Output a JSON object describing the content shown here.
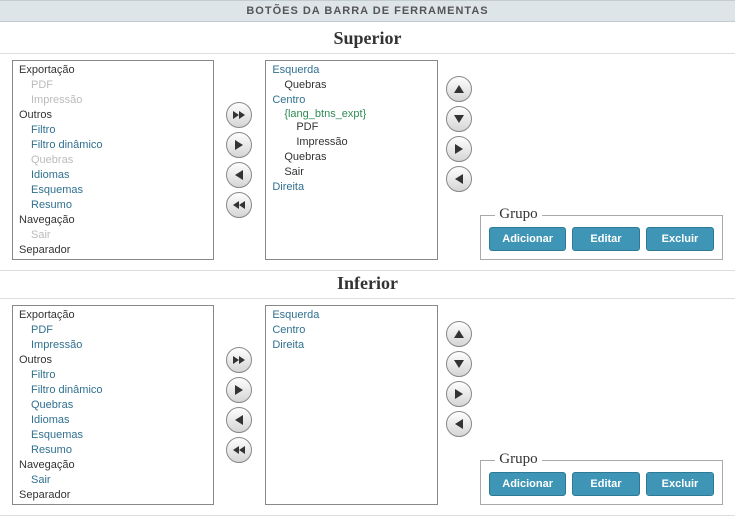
{
  "header": "BOTÕES DA BARRA DE FERRAMENTAS",
  "sections": {
    "top": {
      "title": "Superior",
      "left_list": {
        "cats": [
          {
            "label": "Exportação",
            "items": [
              {
                "label": "PDF",
                "disabled": true
              },
              {
                "label": "Impressão",
                "disabled": true
              }
            ]
          },
          {
            "label": "Outros",
            "items": [
              {
                "label": "Filtro"
              },
              {
                "label": "Filtro dinâmico"
              },
              {
                "label": "Quebras",
                "disabled": true
              },
              {
                "label": "Idiomas"
              },
              {
                "label": "Esquemas"
              },
              {
                "label": "Resumo"
              }
            ]
          },
          {
            "label": "Navegação",
            "items": [
              {
                "label": "Sair",
                "disabled": true
              }
            ]
          },
          {
            "label": "Separador",
            "items": [
              {
                "label": "------------------------",
                "sep": true
              }
            ]
          }
        ]
      },
      "right_list": {
        "rows": [
          {
            "label": "Esquerda",
            "cls": "cat"
          },
          {
            "label": "Quebras",
            "cls": "item"
          },
          {
            "label": "Centro",
            "cls": "cat"
          },
          {
            "label": "{lang_btns_expt}",
            "cls": "cat-green"
          },
          {
            "label": "PDF",
            "cls": "item sub"
          },
          {
            "label": "Impressão",
            "cls": "item sub"
          },
          {
            "label": "Quebras",
            "cls": "item"
          },
          {
            "label": "Sair",
            "cls": "item"
          },
          {
            "label": "Direita",
            "cls": "cat"
          }
        ]
      }
    },
    "bottom": {
      "title": "Inferior",
      "left_list": {
        "cats": [
          {
            "label": "Exportação",
            "items": [
              {
                "label": "PDF"
              },
              {
                "label": "Impressão"
              }
            ]
          },
          {
            "label": "Outros",
            "items": [
              {
                "label": "Filtro"
              },
              {
                "label": "Filtro dinâmico"
              },
              {
                "label": "Quebras"
              },
              {
                "label": "Idiomas"
              },
              {
                "label": "Esquemas"
              },
              {
                "label": "Resumo"
              }
            ]
          },
          {
            "label": "Navegação",
            "items": [
              {
                "label": "Sair"
              }
            ]
          },
          {
            "label": "Separador",
            "items": [
              {
                "label": "------------------------",
                "sep": true
              }
            ]
          }
        ]
      },
      "right_list": {
        "rows": [
          {
            "label": "Esquerda",
            "cls": "cat"
          },
          {
            "label": "Centro",
            "cls": "cat"
          },
          {
            "label": "Direita",
            "cls": "cat"
          }
        ]
      }
    }
  },
  "group": {
    "legend": "Grupo",
    "add": "Adicionar",
    "edit": "Editar",
    "del": "Excluir"
  }
}
